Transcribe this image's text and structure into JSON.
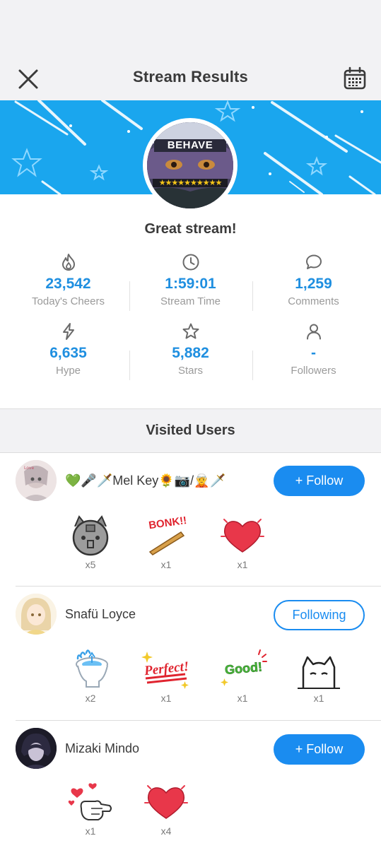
{
  "header": {
    "title": "Stream Results",
    "close_icon": "close-icon",
    "calendar_icon": "calendar-icon"
  },
  "banner": {
    "color": "#1aa6ee",
    "avatar_text": "BEHAVE",
    "avatar_stars": "★★★★★★★★★★"
  },
  "summary": "Great stream!",
  "stats": [
    {
      "icon": "flame-icon",
      "value": "23,542",
      "label": "Today's Cheers"
    },
    {
      "icon": "clock-icon",
      "value": "1:59:01",
      "label": "Stream Time"
    },
    {
      "icon": "comment-icon",
      "value": "1,259",
      "label": "Comments"
    },
    {
      "icon": "bolt-icon",
      "value": "6,635",
      "label": "Hype"
    },
    {
      "icon": "star-icon",
      "value": "5,882",
      "label": "Stars"
    },
    {
      "icon": "person-icon",
      "value": "-",
      "label": "Followers"
    }
  ],
  "visited": {
    "title": "Visited Users",
    "users": [
      {
        "name": "💚🎤🗡️Mel Key🌻📷/🧝🗡️",
        "button": "+ Follow",
        "gifts": [
          {
            "icon": "cat-robot-icon",
            "count": "x5"
          },
          {
            "icon": "bonk-bat-icon",
            "text": "BONK!!",
            "count": "x1"
          },
          {
            "icon": "heart-icon",
            "count": "x1"
          }
        ]
      },
      {
        "name": "Snafü Loyce",
        "button": "Following",
        "gifts": [
          {
            "icon": "toilet-icon",
            "count": "x2"
          },
          {
            "icon": "perfect-sticker-icon",
            "text": "Perfect!",
            "count": "x1"
          },
          {
            "icon": "good-sticker-icon",
            "text": "Good!",
            "count": "x1"
          },
          {
            "icon": "peeking-cat-icon",
            "count": "x1"
          }
        ]
      },
      {
        "name": "Mizaki Mindo",
        "button": "+ Follow",
        "gifts": [
          {
            "icon": "hand-hearts-icon",
            "count": "x1"
          },
          {
            "icon": "heart-icon",
            "count": "x4"
          }
        ]
      }
    ]
  },
  "colors": {
    "accent": "#1a8cf0",
    "stat_value": "#1f8fe0",
    "muted": "#9a9a9a",
    "heart": "#e8374a"
  }
}
